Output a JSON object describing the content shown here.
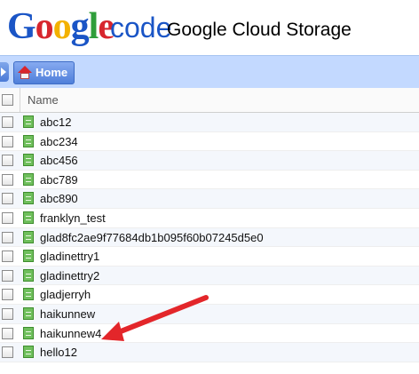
{
  "header": {
    "logo_letters": [
      {
        "ch": "G",
        "color": "#1a55c6"
      },
      {
        "ch": "o",
        "color": "#d7262e"
      },
      {
        "ch": "o",
        "color": "#f3b100"
      },
      {
        "ch": "g",
        "color": "#1a55c6"
      },
      {
        "ch": "l",
        "color": "#2f9e3a"
      },
      {
        "ch": "e",
        "color": "#d7262e"
      }
    ],
    "code_word": "code",
    "app_title": "Google Cloud Storage"
  },
  "toolbar": {
    "home_label": "Home"
  },
  "grid": {
    "name_header": "Name",
    "files": [
      "abc12",
      "abc234",
      "abc456",
      "abc789",
      "abc890",
      "franklyn_test",
      "glad8fc2ae9f77684db1b095f60b07245d5e0",
      "gladinettry1",
      "gladinettry2",
      "gladjerryh",
      "haikunnew",
      "haikunnew4",
      "hello12"
    ]
  },
  "colors": {
    "toolbar_bg": "#c3d9ff",
    "annotation_arrow": "#e3262a"
  }
}
